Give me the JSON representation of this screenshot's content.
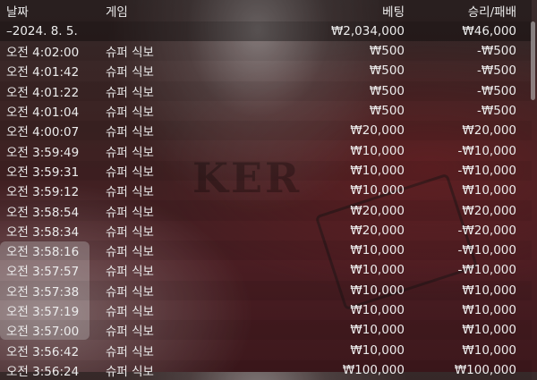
{
  "header": {
    "date": "날짜",
    "game": "게임",
    "bet": "베팅",
    "result": "승리/패배"
  },
  "group": {
    "date": "–2024. 8. 5.",
    "bet": "₩2,034,000",
    "result": "₩46,000"
  },
  "rows": [
    {
      "time": "오전 4:02:00",
      "game": "슈퍼 식보",
      "bet": "₩500",
      "result": "-₩500"
    },
    {
      "time": "오전 4:01:42",
      "game": "슈퍼 식보",
      "bet": "₩500",
      "result": "-₩500"
    },
    {
      "time": "오전 4:01:22",
      "game": "슈퍼 식보",
      "bet": "₩500",
      "result": "-₩500"
    },
    {
      "time": "오전 4:01:04",
      "game": "슈퍼 식보",
      "bet": "₩500",
      "result": "-₩500"
    },
    {
      "time": "오전 4:00:07",
      "game": "슈퍼 식보",
      "bet": "₩20,000",
      "result": "₩20,000"
    },
    {
      "time": "오전 3:59:49",
      "game": "슈퍼 식보",
      "bet": "₩10,000",
      "result": "-₩10,000"
    },
    {
      "time": "오전 3:59:31",
      "game": "슈퍼 식보",
      "bet": "₩10,000",
      "result": "-₩10,000"
    },
    {
      "time": "오전 3:59:12",
      "game": "슈퍼 식보",
      "bet": "₩10,000",
      "result": "₩10,000"
    },
    {
      "time": "오전 3:58:54",
      "game": "슈퍼 식보",
      "bet": "₩20,000",
      "result": "₩20,000"
    },
    {
      "time": "오전 3:58:34",
      "game": "슈퍼 식보",
      "bet": "₩20,000",
      "result": "-₩20,000"
    },
    {
      "time": "오전 3:58:16",
      "game": "슈퍼 식보",
      "bet": "₩10,000",
      "result": "-₩10,000"
    },
    {
      "time": "오전 3:57:57",
      "game": "슈퍼 식보",
      "bet": "₩10,000",
      "result": "-₩10,000"
    },
    {
      "time": "오전 3:57:38",
      "game": "슈퍼 식보",
      "bet": "₩10,000",
      "result": "₩10,000"
    },
    {
      "time": "오전 3:57:19",
      "game": "슈퍼 식보",
      "bet": "₩10,000",
      "result": "₩10,000"
    },
    {
      "time": "오전 3:57:00",
      "game": "슈퍼 식보",
      "bet": "₩10,000",
      "result": "₩10,000"
    },
    {
      "time": "오전 3:56:42",
      "game": "슈퍼 식보",
      "bet": "₩10,000",
      "result": "₩10,000"
    },
    {
      "time": "오전 3:56:24",
      "game": "슈퍼 식보",
      "bet": "₩100,000",
      "result": "₩100,000"
    }
  ],
  "background_text": "KER",
  "selected_row_index": 2,
  "colors": {
    "text": "#ececec",
    "background": "#3b2222"
  }
}
